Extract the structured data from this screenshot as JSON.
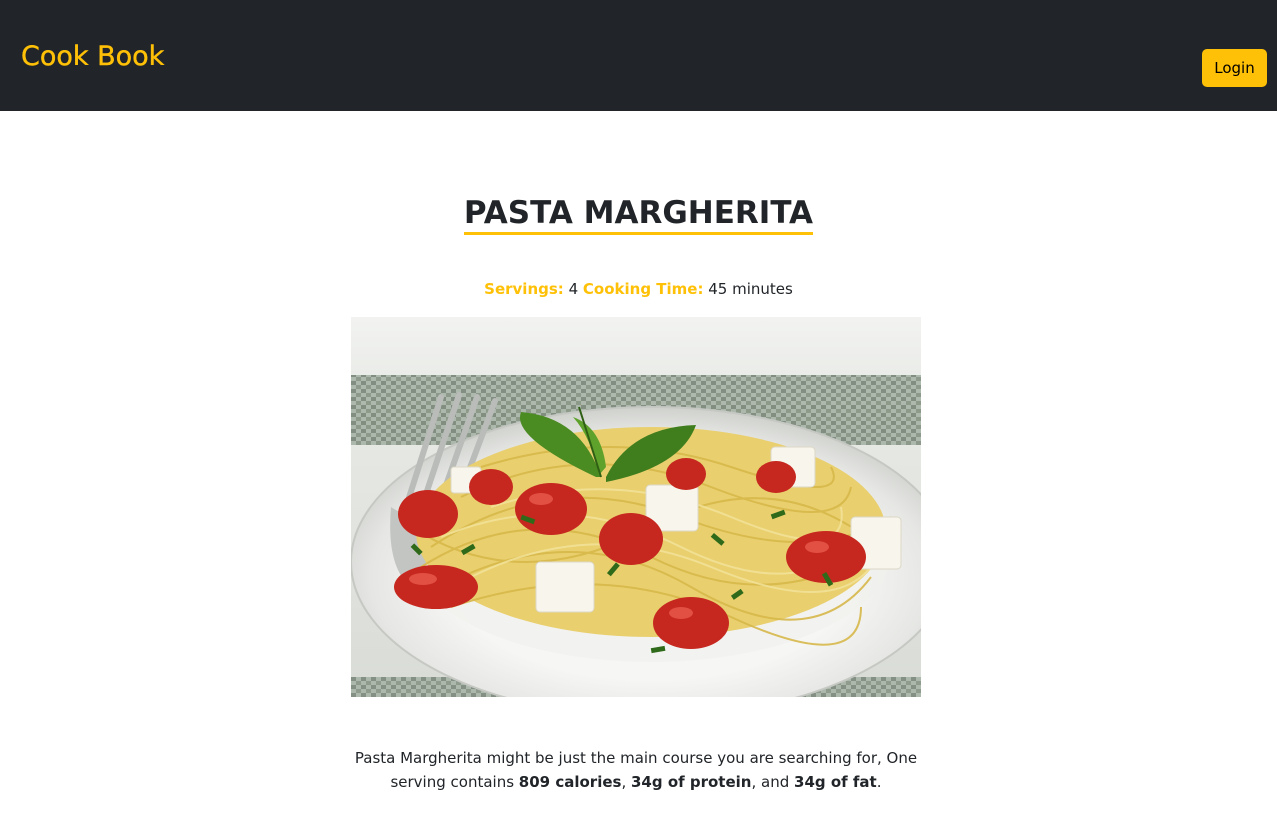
{
  "navbar": {
    "brand": "Cook Book",
    "login_label": "Login"
  },
  "recipe": {
    "title": "PASTA MARGHERITA",
    "servings_label": "Servings:",
    "servings_value": "4",
    "cooking_time_label": "Cooking Time:",
    "cooking_time_value": "45 minutes",
    "image_subject": "pasta-margherita-photo",
    "description": {
      "intro": "Pasta Margherita might be just the main course you are searching for, One serving contains ",
      "calories": "809 calories",
      "sep1": ", ",
      "protein": "34g of protein",
      "sep2": ", and ",
      "fat": "34g of fat",
      "end": "."
    }
  },
  "colors": {
    "accent": "#ffc107",
    "navbar_bg": "#212529",
    "text": "#212529"
  }
}
